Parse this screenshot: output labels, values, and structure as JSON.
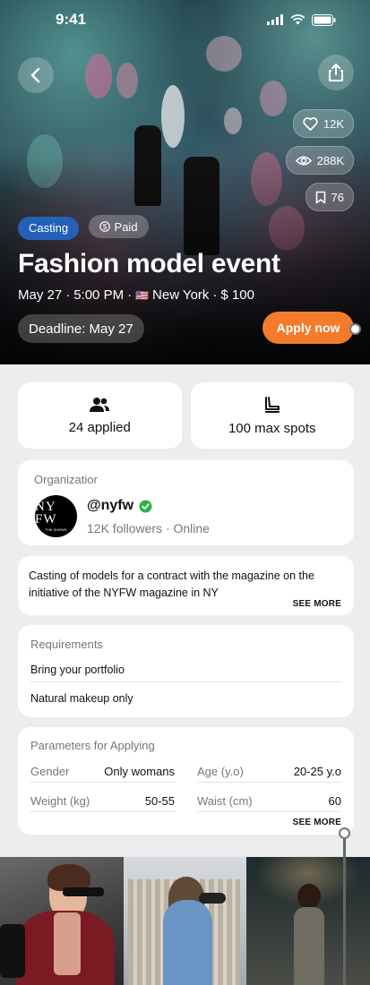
{
  "status": {
    "time": "9:41"
  },
  "hero": {
    "likes": "12K",
    "views": "288K",
    "saves": "76",
    "tag_casting": "Casting",
    "tag_paid": "Paid",
    "title": "Fashion model event",
    "meta_date": "May 27",
    "meta_time": "5:00 PM",
    "meta_flag": "🇺🇸",
    "meta_city": "New York",
    "meta_price": "$ 100",
    "deadline": "Deadline: May 27",
    "apply_label": "Apply now"
  },
  "stats": {
    "applied": "24 applied",
    "spots": "100 max spots"
  },
  "organization": {
    "label": "Organizatior",
    "handle": "@nyfw",
    "sub": "12K followers · Online",
    "logo_text": "NY FW",
    "logo_sub": "THE SHOWS"
  },
  "description": {
    "text": "Casting of models for a contract with the magazine on the initiative of the NYFW magazine in NY",
    "see_more": "SEE MORE"
  },
  "requirements": {
    "label": "Requirements",
    "items": [
      "Bring your portfolio",
      "Natural makeup only"
    ]
  },
  "parameters": {
    "label": "Parameters for Applying",
    "gender_label": "Gender",
    "gender_value": "Only womans",
    "age_label": "Age (y.o)",
    "age_value": "20-25 y.o",
    "weight_label": "Weight (kg)",
    "weight_value": "50-55",
    "waist_label": "Waist (cm)",
    "waist_value": "60",
    "see_more": "SEE MORE"
  },
  "colors": {
    "accent_orange": "#f47b2b",
    "casting_blue": "#2460b8",
    "verified_green": "#2fb14a"
  }
}
